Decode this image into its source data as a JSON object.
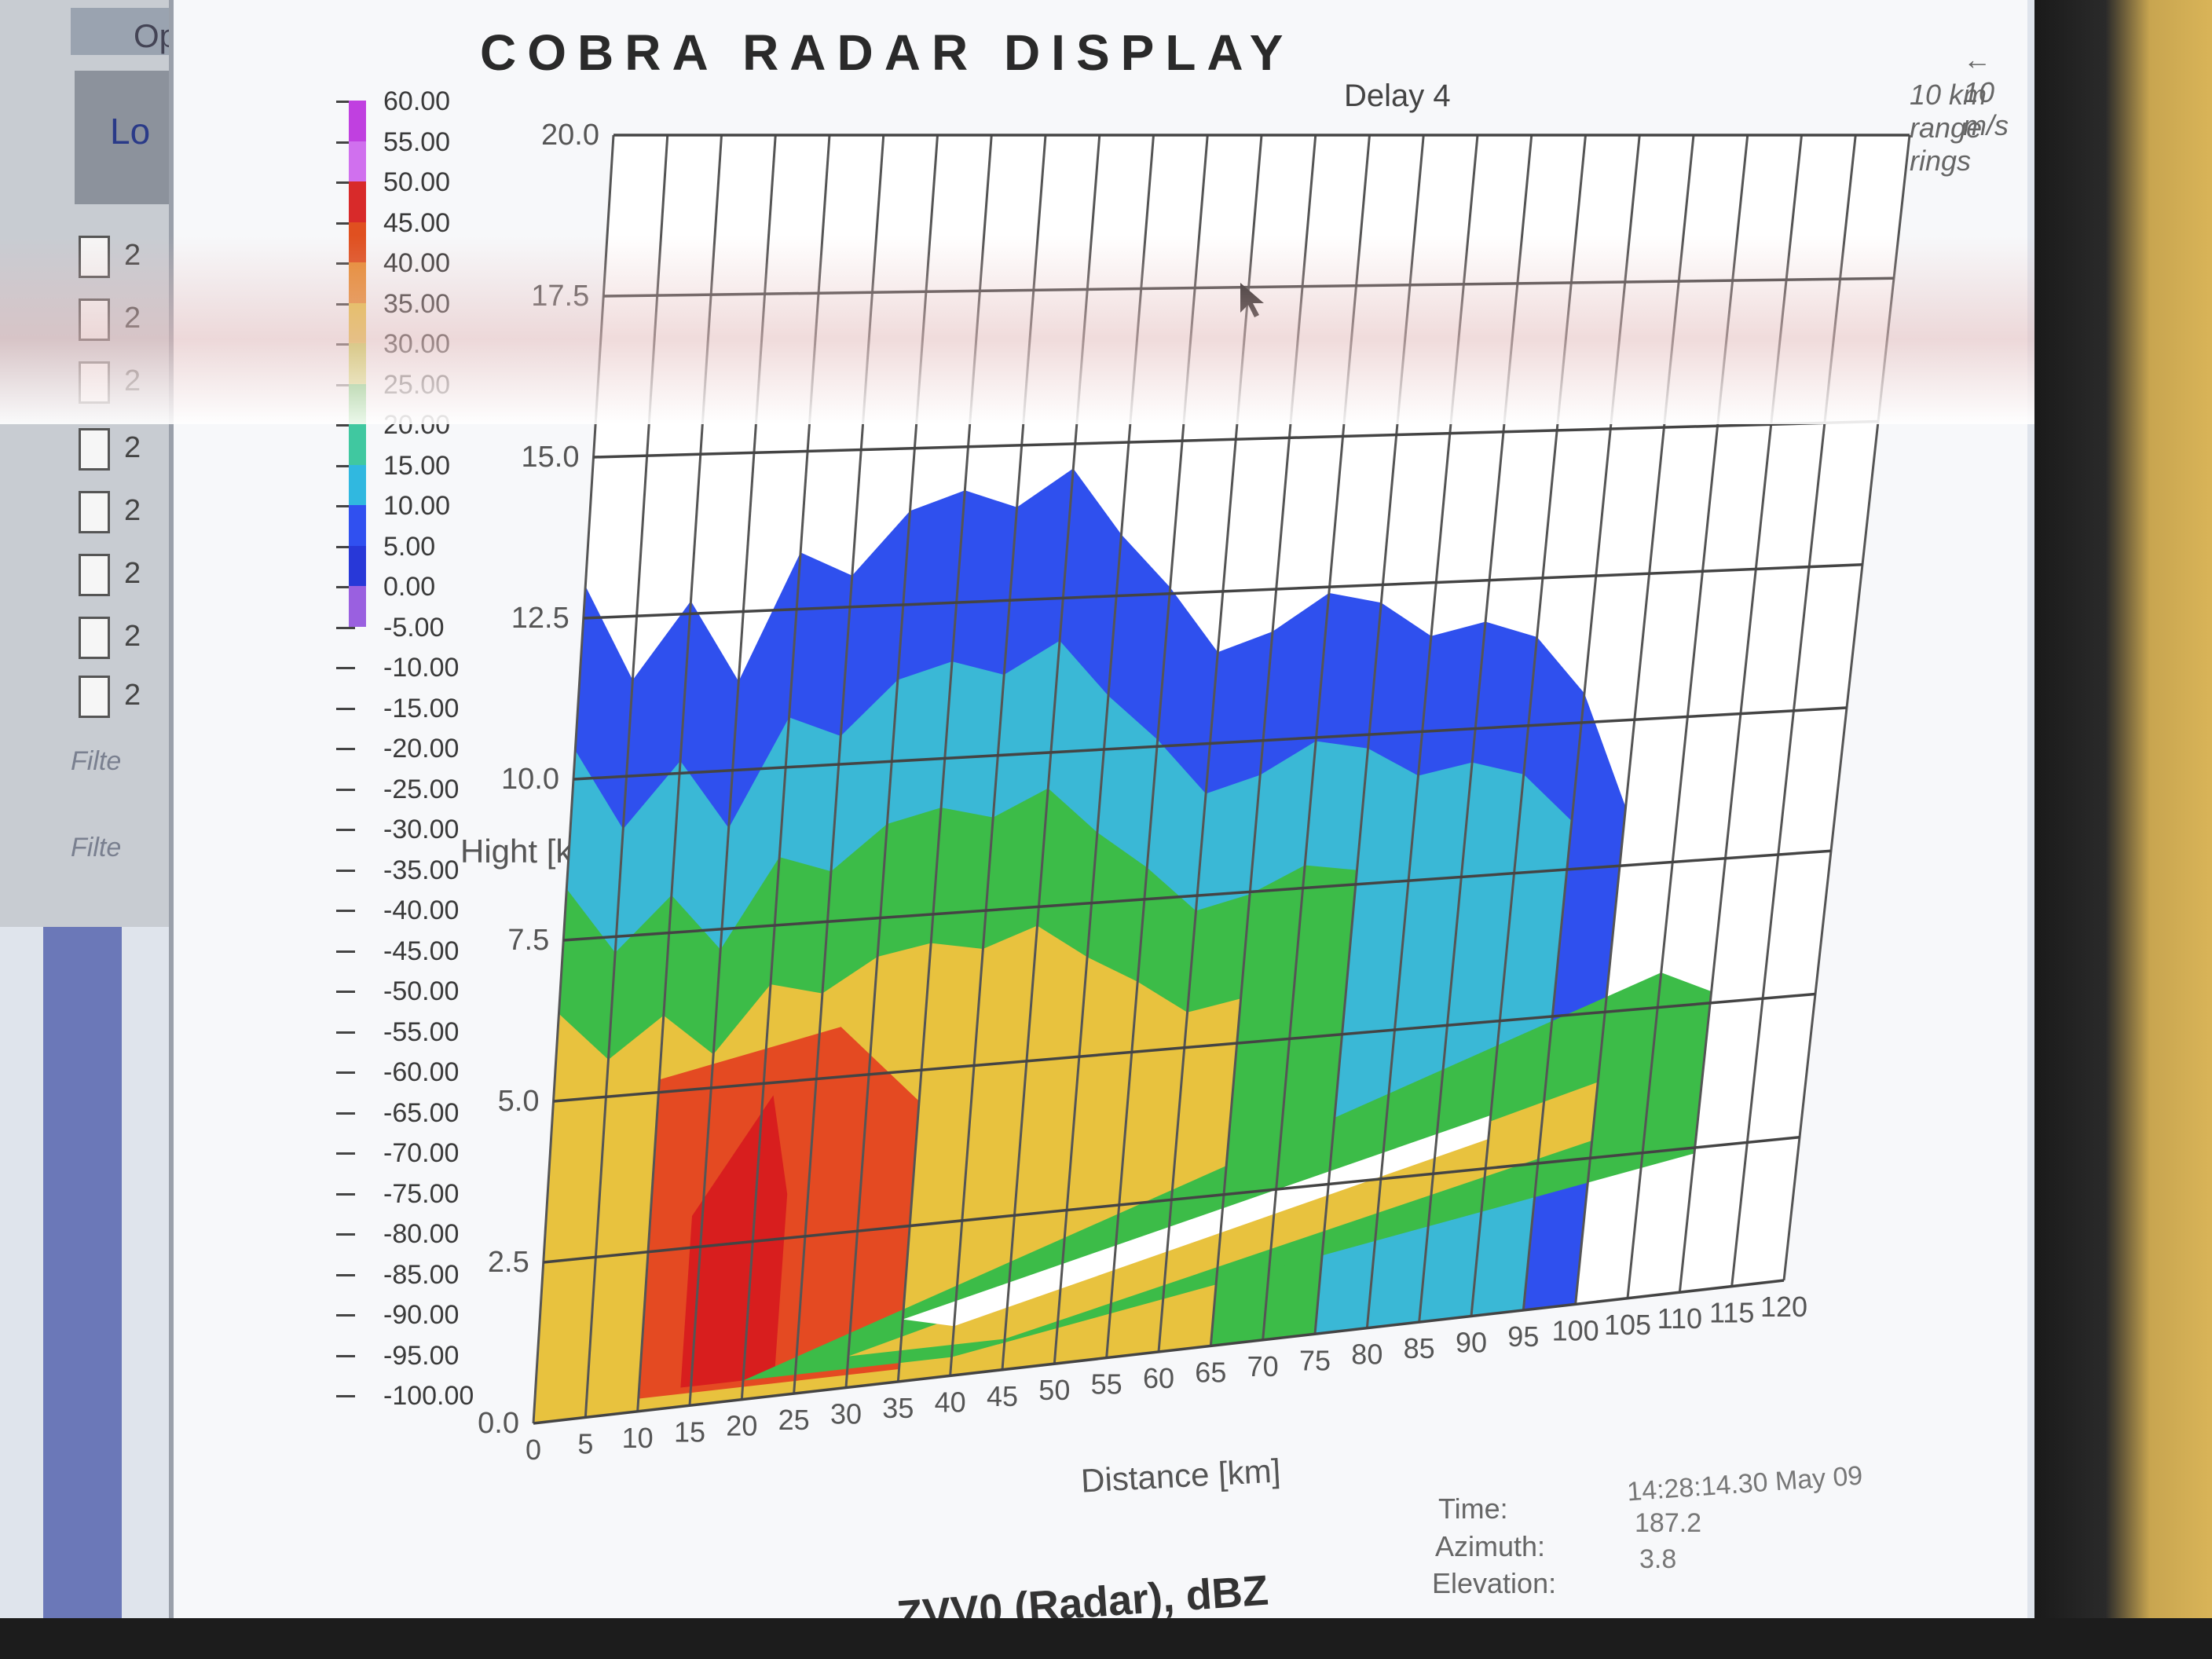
{
  "sidebar": {
    "tab_label": "Op",
    "panel_label": "Lo",
    "files": [
      "2",
      "2",
      "2",
      "2",
      "2",
      "2",
      "2",
      "2"
    ],
    "filter_labels": [
      "Filte",
      "Filte"
    ]
  },
  "window": {
    "title": "COBRA RADAR DISPLAY",
    "delay": "Delay 4",
    "wind_scale": "← 10 m/s",
    "range_rings": "10 km range rings",
    "product": "ZVV0 (Radar), dBZ",
    "time_label": "Time:",
    "time_value": "14:28:14.30 May 09",
    "azimuth_label": "Azimuth:",
    "azimuth_value": "187.2",
    "elevation_label": "Elevation:",
    "elevation_value": "3.8"
  },
  "colorbar": {
    "labels": [
      "60.00",
      "55.00",
      "50.00",
      "45.00",
      "40.00",
      "35.00",
      "30.00",
      "25.00",
      "20.00",
      "15.00",
      "10.00",
      "5.00",
      "0.00",
      "-5.00",
      "-10.00",
      "-15.00",
      "-20.00",
      "-25.00",
      "-30.00",
      "-35.00",
      "-40.00",
      "-45.00",
      "-50.00",
      "-55.00",
      "-60.00",
      "-65.00",
      "-70.00",
      "-75.00",
      "-80.00",
      "-85.00",
      "-90.00",
      "-95.00",
      "-100.00"
    ],
    "colors": [
      "#c040e0",
      "#d070ee",
      "#d82a2a",
      "#e05020",
      "#e88a30",
      "#e8c040",
      "#c8d040",
      "#30b830",
      "#40c8a0",
      "#30b8e0",
      "#3050f0",
      "#2838d8",
      "#9a60e0"
    ]
  },
  "chart_data": {
    "type": "heatmap",
    "xlabel": "Distance [km]",
    "ylabel": "Hight [km]",
    "xlim": [
      0,
      120
    ],
    "ylim": [
      0,
      20
    ],
    "x_ticks": [
      "0",
      "5",
      "10",
      "15",
      "20",
      "25",
      "30",
      "35",
      "40",
      "45",
      "50",
      "55",
      "60",
      "65",
      "70",
      "75",
      "80",
      "85",
      "90",
      "95",
      "100",
      "105",
      "110",
      "115",
      "120"
    ],
    "y_ticks": [
      "0.0",
      "2.5",
      "5.0",
      "7.5",
      "10.0",
      "12.5",
      "15.0",
      "17.5",
      "20.0"
    ],
    "units": "dBZ",
    "grid": true,
    "echo_top_profile_km": [
      [
        0,
        13.0
      ],
      [
        5,
        11.5
      ],
      [
        10,
        12.7
      ],
      [
        15,
        11.4
      ],
      [
        20,
        13.4
      ],
      [
        25,
        13.0
      ],
      [
        30,
        14.0
      ],
      [
        35,
        14.3
      ],
      [
        40,
        14.0
      ],
      [
        45,
        14.6
      ],
      [
        50,
        13.5
      ],
      [
        55,
        12.6
      ],
      [
        60,
        11.5
      ],
      [
        65,
        11.8
      ],
      [
        70,
        12.4
      ],
      [
        75,
        12.2
      ],
      [
        80,
        11.6
      ],
      [
        85,
        11.8
      ],
      [
        90,
        11.5
      ],
      [
        95,
        10.5
      ],
      [
        100,
        8.5
      ]
    ],
    "core_max_dbz": 50,
    "core_range_km": [
      10,
      35
    ]
  }
}
